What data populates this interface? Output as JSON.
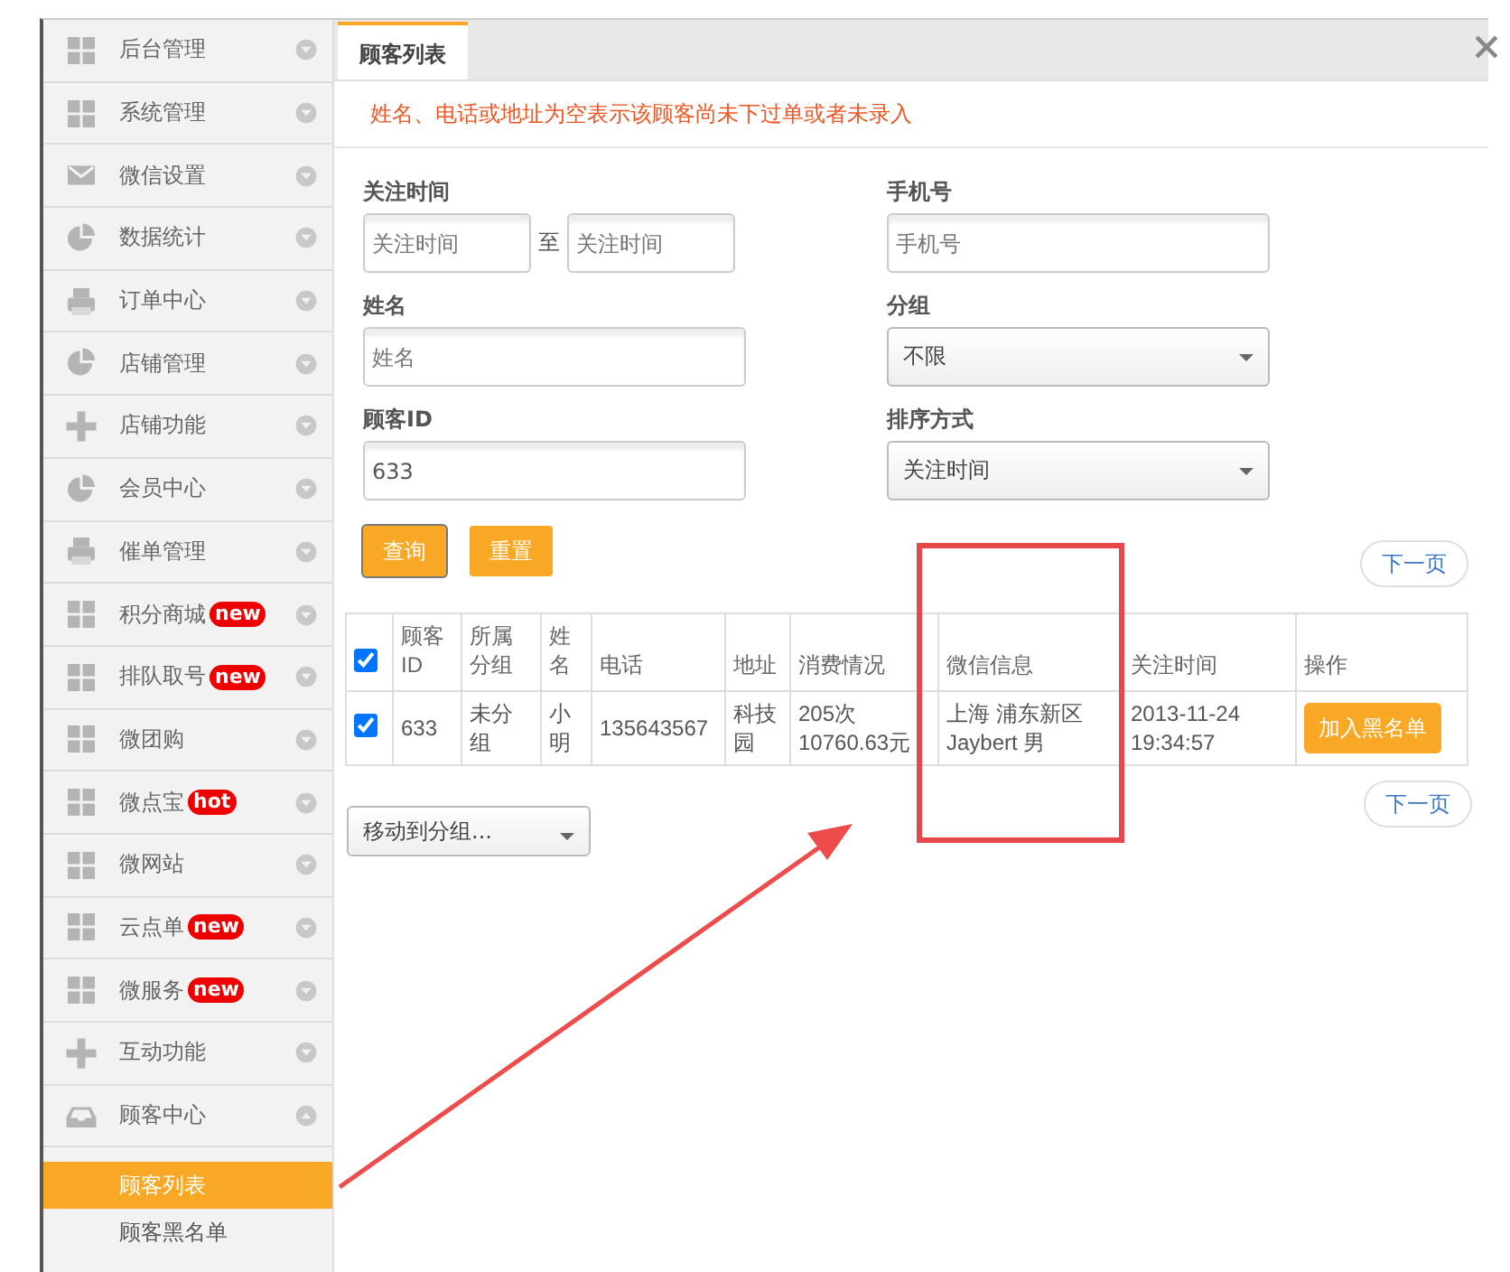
{
  "sidebar": {
    "items": [
      {
        "label": "后台管理",
        "kind": "grid",
        "expanded": false
      },
      {
        "label": "系统管理",
        "kind": "grid",
        "expanded": false
      },
      {
        "label": "微信设置",
        "kind": "mail",
        "expanded": false
      },
      {
        "label": "数据统计",
        "kind": "pie",
        "expanded": false
      },
      {
        "label": "订单中心",
        "kind": "printer",
        "expanded": false
      },
      {
        "label": "店铺管理",
        "kind": "pie",
        "expanded": false
      },
      {
        "label": "店铺功能",
        "kind": "plus",
        "expanded": false
      },
      {
        "label": "会员中心",
        "kind": "pie",
        "expanded": false
      },
      {
        "label": "催单管理",
        "kind": "printer",
        "expanded": false
      },
      {
        "label": "积分商城",
        "kind": "grid",
        "badge": "new",
        "expanded": false
      },
      {
        "label": "排队取号",
        "kind": "grid",
        "badge": "new",
        "expanded": false
      },
      {
        "label": "微团购",
        "kind": "grid",
        "expanded": false
      },
      {
        "label": "微点宝",
        "kind": "grid",
        "badge": "hot",
        "expanded": false
      },
      {
        "label": "微网站",
        "kind": "grid",
        "expanded": false
      },
      {
        "label": "云点单",
        "kind": "grid",
        "badge": "new",
        "expanded": false
      },
      {
        "label": "微服务",
        "kind": "grid",
        "badge": "new",
        "expanded": false
      },
      {
        "label": "互动功能",
        "kind": "plus",
        "expanded": false
      },
      {
        "label": "顾客中心",
        "kind": "tray",
        "expanded": true,
        "children": [
          {
            "label": "顾客列表",
            "selected": true
          },
          {
            "label": "顾客黑名单",
            "selected": false
          }
        ]
      }
    ]
  },
  "tabs": [
    {
      "label": "顾客列表",
      "selected": true
    }
  ],
  "notice": "姓名、电话或地址为空表示该顾客尚未下过单或者未录入",
  "filters": {
    "follow_time": {
      "label": "关注时间",
      "from_placeholder": "关注时间",
      "separator": "至",
      "to_placeholder": "关注时间"
    },
    "phone": {
      "label": "手机号",
      "placeholder": "手机号"
    },
    "name": {
      "label": "姓名",
      "placeholder": "姓名"
    },
    "group": {
      "label": "分组",
      "value": "不限"
    },
    "customer_id": {
      "label": "顾客ID",
      "value": "633"
    },
    "sort": {
      "label": "排序方式",
      "value": "关注时间"
    }
  },
  "buttons": [
    "查询",
    "重置"
  ],
  "next_page": "下一页",
  "table": {
    "select_all": true,
    "columns": [
      "顾客ID",
      "所属分组",
      "姓名",
      "电话",
      "地址",
      "消费情况",
      "微信信息",
      "关注时间",
      "操作"
    ],
    "rows": [
      {
        "checked": true,
        "cells": [
          [
            "633"
          ],
          [
            "未分组"
          ],
          [
            "小明"
          ],
          [
            "135643567"
          ],
          [
            "科技园"
          ],
          [
            "205次",
            "10760.63元"
          ],
          [
            "上海 浦东新区",
            "Jaybert 男"
          ],
          [
            "2013-11-24",
            "19:34:57"
          ]
        ],
        "action": "加入黑名单"
      }
    ]
  },
  "next_page_bottom": "下一页",
  "move_to_group": "移动到分组..."
}
